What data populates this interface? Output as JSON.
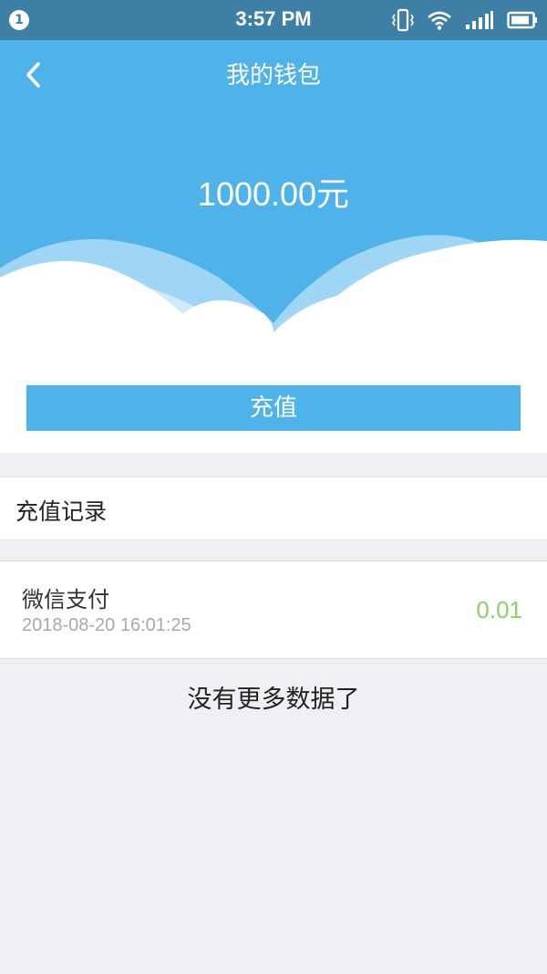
{
  "status": {
    "notification_count": "1",
    "time": "3:57 PM"
  },
  "header": {
    "title": "我的钱包",
    "balance": "1000.00元"
  },
  "actions": {
    "recharge_label": "充值"
  },
  "records_section": {
    "title": "充值记录"
  },
  "records": [
    {
      "method": "微信支付",
      "time": "2018-08-20 16:01:25",
      "amount": "0.01"
    }
  ],
  "footer": {
    "no_more": "没有更多数据了"
  },
  "colors": {
    "primary": "#4fb3ea",
    "statusbar": "#3e7fa6",
    "amount_green": "#8bcf6e",
    "background": "#efeff4"
  }
}
